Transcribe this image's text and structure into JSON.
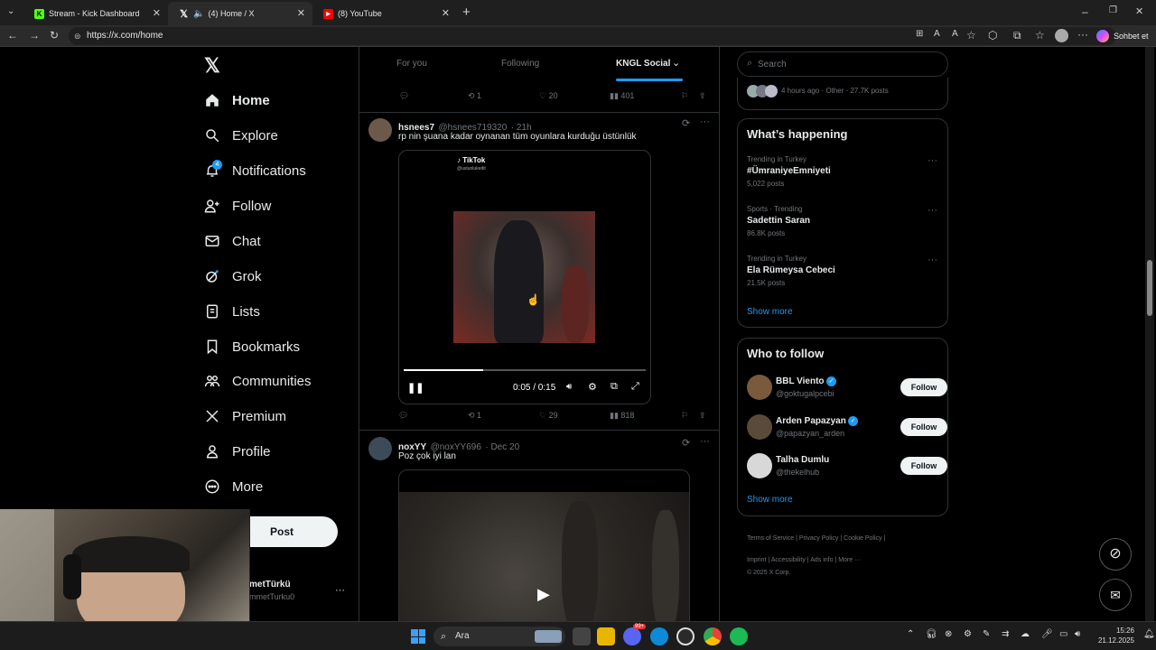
{
  "browser": {
    "tabs": [
      {
        "title": "Stream - Kick Dashboard",
        "active": false,
        "fav_color": "#53fc18"
      },
      {
        "title": "(4) Home / X",
        "active": true,
        "fav_color": "#ffffff"
      },
      {
        "title": "(8) YouTube",
        "active": false,
        "fav_color": "#ff0000"
      }
    ],
    "url": "https://x.com/home",
    "copilot_label": "Sohbet et"
  },
  "nav": {
    "items": [
      {
        "label": "Home",
        "icon": "home-icon"
      },
      {
        "label": "Explore",
        "icon": "search-icon"
      },
      {
        "label": "Notifications",
        "icon": "bell-icon",
        "badge": "4"
      },
      {
        "label": "Follow",
        "icon": "person-plus-icon"
      },
      {
        "label": "Chat",
        "icon": "mail-icon"
      },
      {
        "label": "Grok",
        "icon": "grok-icon"
      },
      {
        "label": "Lists",
        "icon": "list-icon"
      },
      {
        "label": "Bookmarks",
        "icon": "bookmark-icon"
      },
      {
        "label": "Communities",
        "icon": "people-icon"
      },
      {
        "label": "Premium",
        "icon": "x-logo-icon"
      },
      {
        "label": "Profile",
        "icon": "person-icon"
      },
      {
        "label": "More",
        "icon": "more-circle-icon"
      }
    ],
    "post_label": "Post",
    "account_name": "metTürkü",
    "account_handle": "mmetTurku0"
  },
  "feed": {
    "tabs": [
      "For you",
      "Following",
      "KNGL Social"
    ],
    "prev_actions": {
      "replies": "",
      "retweets": "1",
      "likes": "20",
      "views": "401"
    },
    "tweets": [
      {
        "name": "hsnees7",
        "handle": "@hsnees719320",
        "time": "· 21h",
        "text": "rp nin şuana kadar oynanan tüm oyunlara kurduğu üstünlük",
        "media_watermark": "TikTok",
        "media_watermark_user": "@ustunlukedit",
        "video_time": "0:05 / 0:15",
        "progress": 0.33,
        "actions": {
          "replies": "",
          "retweets": "1",
          "likes": "29",
          "views": "818"
        }
      },
      {
        "name": "noxYY",
        "handle": "@noxYY696",
        "time": "· Dec 20",
        "text": "Poz çok iyi lan"
      }
    ]
  },
  "sidebar": {
    "search_placeholder": "Search",
    "top_meta": "4 hours ago · Other · 27.7K posts",
    "happening_title": "What’s happening",
    "trends": [
      {
        "category": "Trending in Turkey",
        "name": "#ÜmraniyeEmniyeti",
        "count": "5,022 posts"
      },
      {
        "category": "Sports · Trending",
        "name": "Sadettin Saran",
        "count": "86.8K posts"
      },
      {
        "category": "Trending in Turkey",
        "name": "Ela Rümeysa Cebeci",
        "count": "21.5K posts"
      }
    ],
    "show_more": "Show more",
    "who_title": "Who to follow",
    "follows": [
      {
        "name": "BBL Viento",
        "handle": "@goktugalpcebi",
        "verified": true,
        "button": "Follow"
      },
      {
        "name": "Arden Papazyan",
        "handle": "@papazyan_arden",
        "verified": true,
        "button": "Follow"
      },
      {
        "name": "Talha Dumlu",
        "handle": "@thekelhub",
        "verified": false,
        "button": "Follow"
      }
    ],
    "footer": {
      "row1": [
        "Terms of Service",
        "Privacy Policy",
        "Cookie Policy"
      ],
      "row2": [
        "Imprint",
        "Accessibility",
        "Ads info",
        "More ···"
      ],
      "copyright": "© 2025 X Corp."
    }
  },
  "taskbar": {
    "search_label": "Ara",
    "badge": "99+",
    "time": "15:26",
    "date": "21.12.2025"
  },
  "colors": {
    "accent": "#1d9bf0",
    "background": "#000000",
    "border": "#2f3336",
    "muted": "#71767b"
  }
}
